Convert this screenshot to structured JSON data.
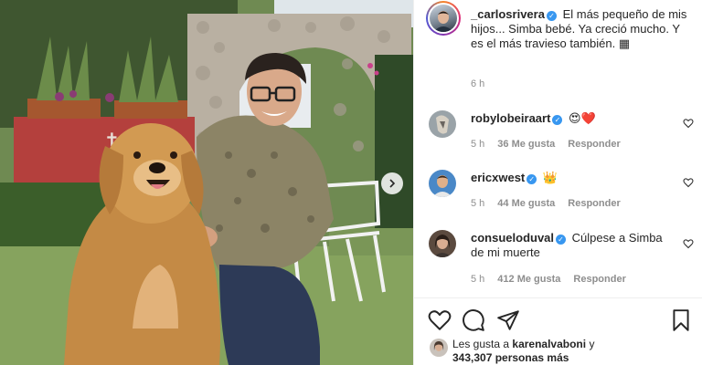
{
  "post": {
    "author": "_carlosrivera",
    "caption": "El más pequeño de mis hijos... Simba bebé. Ya creció mucho. Y es el más travieso también.",
    "caption_emoji": "▦",
    "time": "6 h"
  },
  "comments": [
    {
      "user": "robylobeiraart",
      "text": "😍❤️",
      "time": "5 h",
      "likes": "36 Me gusta",
      "reply": "Responder"
    },
    {
      "user": "ericxwest",
      "text": "👑",
      "time": "5 h",
      "likes": "44 Me gusta",
      "reply": "Responder"
    },
    {
      "user": "consueloduval",
      "text": "Cúlpese a Simba de mi muerte",
      "time": "5 h",
      "likes": "412 Me gusta",
      "reply": "Responder"
    }
  ],
  "likes": {
    "prefix": "Les gusta a",
    "user": "karenalvaboni",
    "suffix": "y",
    "count": "343,307 personas más"
  },
  "icons": [
    "heart-icon",
    "comment-icon",
    "share-icon",
    "bookmark-icon",
    "chevron-right-icon",
    "verified-icon"
  ],
  "colors": {
    "verified": "#3897f0",
    "meta": "#8e8e8e",
    "text": "#262626"
  }
}
